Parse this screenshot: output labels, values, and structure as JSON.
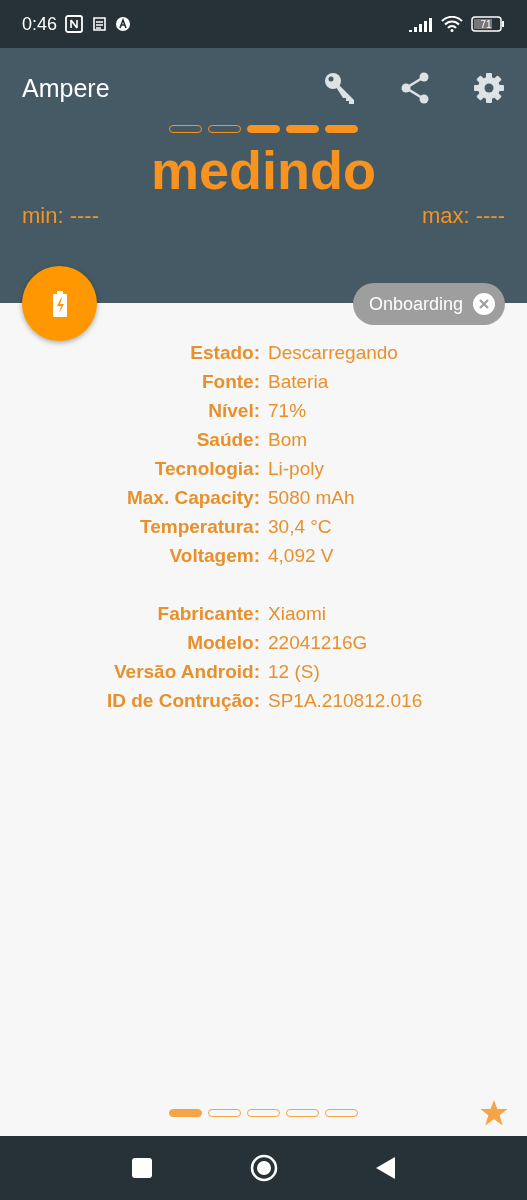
{
  "status_bar": {
    "time": "0:46",
    "battery": "71"
  },
  "app_bar": {
    "title": "Ampere"
  },
  "meter": {
    "segments": [
      {
        "filled": false
      },
      {
        "filled": false
      },
      {
        "filled": true
      },
      {
        "filled": true
      },
      {
        "filled": true
      }
    ],
    "reading": "medindo",
    "min": "min: ----",
    "max": "max: ----"
  },
  "chip": {
    "label": "Onboarding"
  },
  "groups": [
    [
      {
        "label": "Estado:",
        "value": "Descarregando"
      },
      {
        "label": "Fonte:",
        "value": "Bateria"
      },
      {
        "label": "Nível:",
        "value": "71%"
      },
      {
        "label": "Saúde:",
        "value": "Bom"
      },
      {
        "label": "Tecnologia:",
        "value": "Li-poly"
      },
      {
        "label": "Max. Capacity:",
        "value": "5080 mAh"
      },
      {
        "label": "Temperatura:",
        "value": "30,4 °C"
      },
      {
        "label": "Voltagem:",
        "value": "4,092 V"
      }
    ],
    [
      {
        "label": "Fabricante:",
        "value": "Xiaomi"
      },
      {
        "label": "Modelo:",
        "value": "22041216G"
      },
      {
        "label": "Versão Android:",
        "value": "12 (S)"
      },
      {
        "label": "ID de Contrução:",
        "value": "SP1A.210812.016"
      }
    ]
  ],
  "pages": [
    {
      "selected": true
    },
    {
      "selected": false
    },
    {
      "selected": false
    },
    {
      "selected": false
    },
    {
      "selected": false
    }
  ]
}
